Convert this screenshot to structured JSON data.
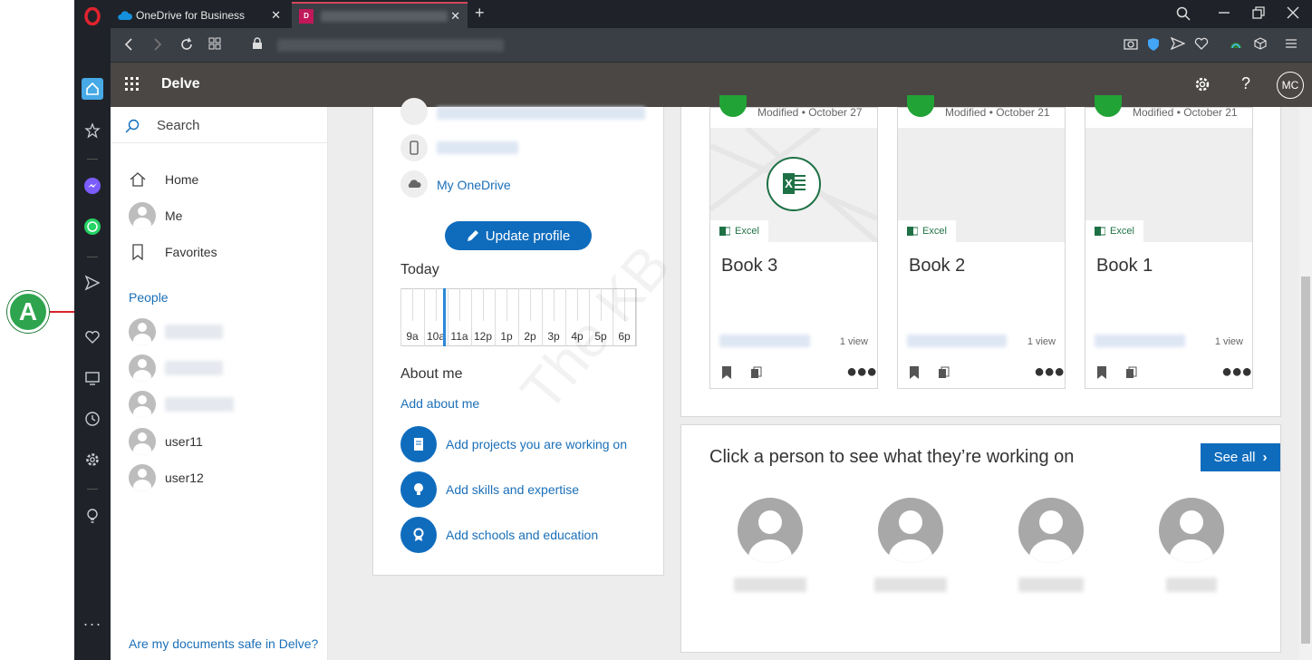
{
  "annotation": {
    "label": "A"
  },
  "browser": {
    "tabs": [
      {
        "label": "OneDrive for Business",
        "close": "✕"
      },
      {
        "label": "",
        "close": "✕"
      }
    ],
    "new_tab": "+"
  },
  "delve": {
    "app_title": "Delve",
    "user_initials": "MC",
    "help": "?"
  },
  "leftnav": {
    "search_placeholder": "Search",
    "items": [
      {
        "label": "Home"
      },
      {
        "label": "Me"
      },
      {
        "label": "Favorites"
      }
    ],
    "people_heading": "People",
    "people": [
      "user11",
      "user12"
    ],
    "footer_link": "Are my documents safe in Delve?"
  },
  "profile": {
    "onedrive": "My OneDrive",
    "update_button": "Update profile",
    "today_label": "Today",
    "hours": [
      "9a",
      "10a",
      "11a",
      "12p",
      "1p",
      "2p",
      "3p",
      "4p",
      "5p",
      "6p"
    ],
    "about_heading": "About me",
    "add_about": "Add about me",
    "actions": [
      {
        "label": "Add projects you are working on"
      },
      {
        "label": "Add skills and expertise"
      },
      {
        "label": "Add schools and education"
      }
    ]
  },
  "documents": [
    {
      "name": "Book 3",
      "modified": "Modified • October 27",
      "type": "Excel",
      "views": "1 view"
    },
    {
      "name": "Book 2",
      "modified": "Modified • October 21",
      "type": "Excel",
      "views": "1 view"
    },
    {
      "name": "Book 1",
      "modified": "Modified • October 21",
      "type": "Excel",
      "views": "1 view"
    }
  ],
  "people_panel": {
    "heading": "Click a person to see what they’re working on",
    "see_all": "See all"
  },
  "watermark": "The KB"
}
